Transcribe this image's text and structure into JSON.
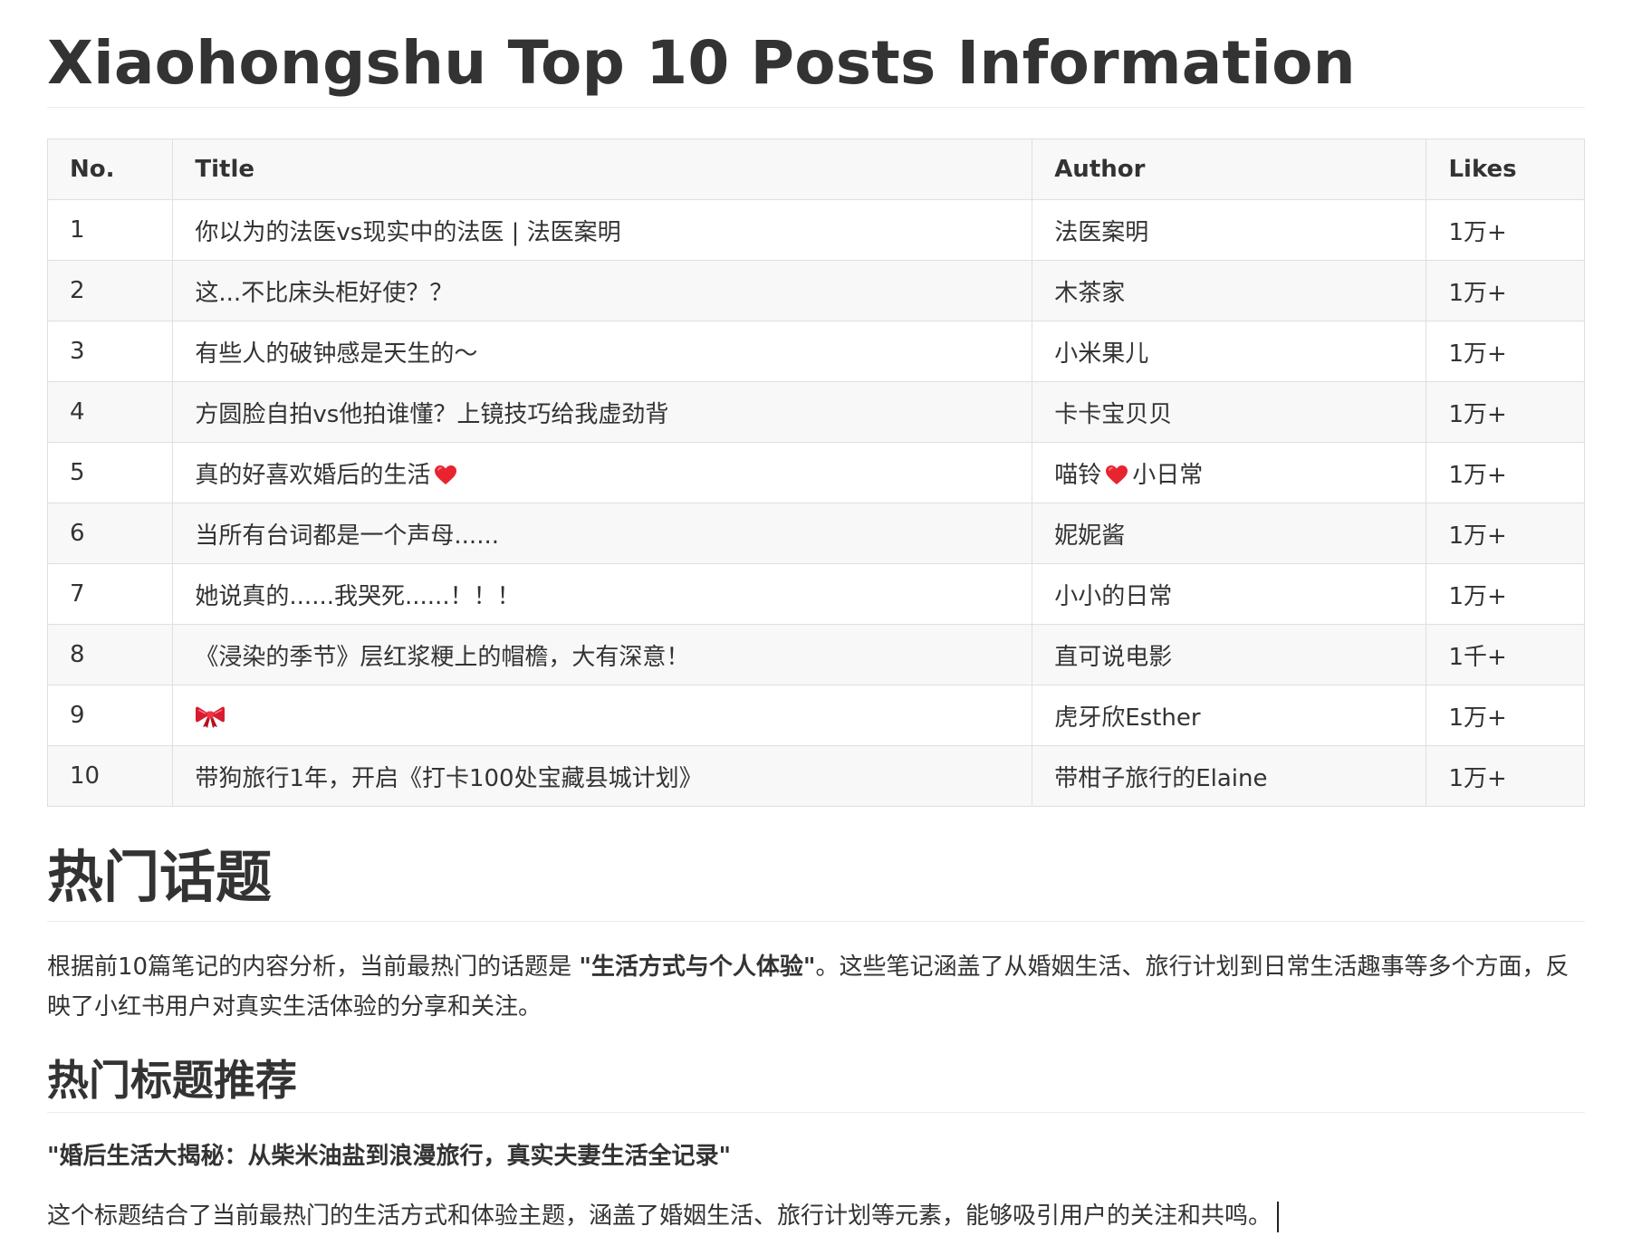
{
  "title": "Xiaohongshu Top 10 Posts Information",
  "table": {
    "headers": {
      "no": "No.",
      "title": "Title",
      "author": "Author",
      "likes": "Likes"
    },
    "rows": [
      {
        "no": "1",
        "title": "你以为的法医vs现实中的法医 | 法医案明",
        "author": "法医案明",
        "likes": "1万+"
      },
      {
        "no": "2",
        "title": "这...不比床头柜好使？？",
        "author": "木茶家",
        "likes": "1万+"
      },
      {
        "no": "3",
        "title": "有些人的破钟感是天生的～",
        "author": "小米果儿",
        "likes": "1万+"
      },
      {
        "no": "4",
        "title": "方圆脸自拍vs他拍谁懂？上镜技巧给我虚劲背",
        "author": "卡卡宝贝贝",
        "likes": "1万+"
      },
      {
        "no": "5",
        "title": "真的好喜欢婚后的生活",
        "author_pre": "喵铃",
        "author_post": "小日常",
        "likes": "1万+",
        "title_icon": "heart-emoji",
        "author_icon": "heart-emoji"
      },
      {
        "no": "6",
        "title": "当所有台词都是一个声母......",
        "author": "妮妮酱",
        "likes": "1万+"
      },
      {
        "no": "7",
        "title": "她说真的......我哭死......！！！",
        "author": "小小的日常",
        "likes": "1万+"
      },
      {
        "no": "8",
        "title": "《浸染的季节》层红浆粳上的帽檐，大有深意！",
        "author": "直可说电影",
        "likes": "1千+"
      },
      {
        "no": "9",
        "title_icon": "ribbon-bow-emoji",
        "author": "虎牙欣Esther",
        "likes": "1万+"
      },
      {
        "no": "10",
        "title": "带狗旅行1年，开启《打卡100处宝藏县城计划》",
        "author": "带柑子旅行的Elaine",
        "likes": "1万+"
      }
    ]
  },
  "hot_topic": {
    "heading": "热门话题",
    "text_before": "根据前10篇笔记的内容分析，当前最热门的话题是 ",
    "bold": "\"生活方式与个人体验\"",
    "text_after": "。这些笔记涵盖了从婚姻生活、旅行计划到日常生活趣事等多个方面，反映了小红书用户对真实生活体验的分享和关注。"
  },
  "recommend": {
    "heading": "热门标题推荐",
    "title": "\"婚后生活大揭秘：从柴米油盐到浪漫旅行，真实夫妻生活全记录\"",
    "description": "这个标题结合了当前最热门的生活方式和体验主题，涵盖了婚姻生活、旅行计划等元素，能够吸引用户的关注和共鸣。"
  },
  "colors": {
    "text": "#333333",
    "border": "#dfdfdf",
    "stripe": "#f8f8f8",
    "heart": "#e8242f",
    "bow": "#d81b2f"
  }
}
